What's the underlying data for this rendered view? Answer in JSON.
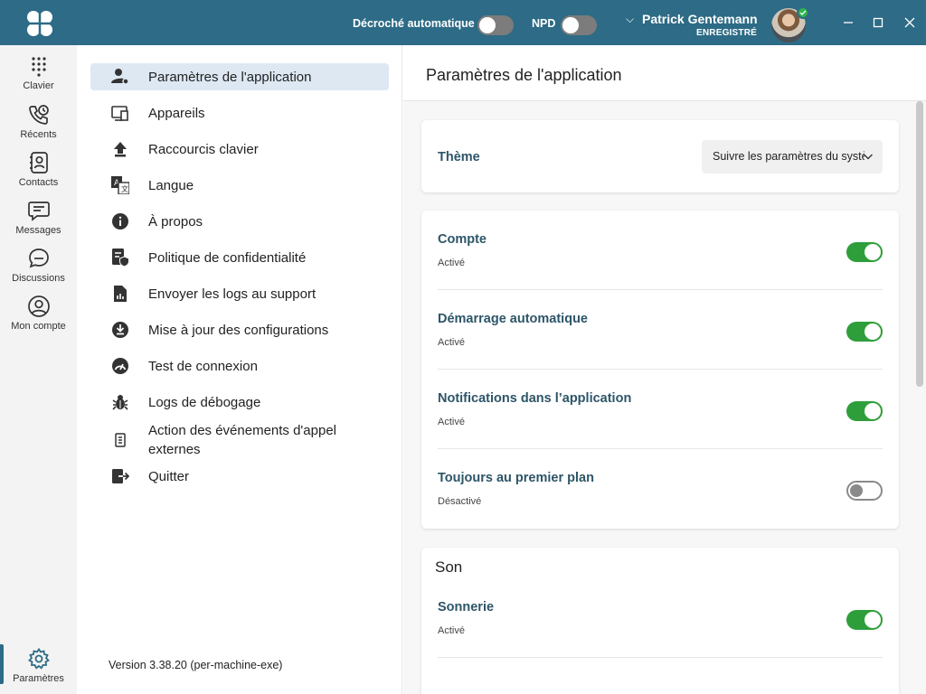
{
  "titlebar": {
    "auto_answer_label": "Décroché automatique",
    "npd_label": "NPD",
    "user_name": "Patrick Gentemann",
    "user_status": "ENREGISTRÉ",
    "status_color": "#2fb44a",
    "brand_color": "#2d6b86"
  },
  "rail": {
    "items": [
      {
        "label": "Clavier",
        "icon": "dialpad-icon"
      },
      {
        "label": "Récents",
        "icon": "recent-calls-icon"
      },
      {
        "label": "Contacts",
        "icon": "contacts-icon"
      },
      {
        "label": "Messages",
        "icon": "messages-icon"
      },
      {
        "label": "Discussions",
        "icon": "discussions-icon"
      },
      {
        "label": "Mon compte",
        "icon": "account-icon"
      }
    ],
    "settings_label": "Paramètres"
  },
  "menu": {
    "items": [
      {
        "label": "Paramètres de l'application",
        "icon": "user-settings-icon"
      },
      {
        "label": "Appareils",
        "icon": "devices-icon"
      },
      {
        "label": "Raccourcis clavier",
        "icon": "shortcut-icon"
      },
      {
        "label": "Langue",
        "icon": "language-icon"
      },
      {
        "label": "À propos",
        "icon": "info-icon"
      },
      {
        "label": "Politique de confidentialité",
        "icon": "privacy-icon"
      },
      {
        "label": "Envoyer les logs au support",
        "icon": "send-logs-icon"
      },
      {
        "label": "Mise à jour des configurations",
        "icon": "download-icon"
      },
      {
        "label": "Test de connexion",
        "icon": "speed-test-icon"
      },
      {
        "label": "Logs de débogage",
        "icon": "bug-icon"
      },
      {
        "label": "Action des événements d'appel externes",
        "icon": "document-icon"
      },
      {
        "label": "Quitter",
        "icon": "exit-icon"
      }
    ],
    "version": "Version 3.38.20 (per-machine-exe)"
  },
  "content": {
    "title": "Paramètres de l'application",
    "theme": {
      "label": "Thème",
      "value": "Suivre les paramètres du système"
    },
    "general_rows": [
      {
        "title": "Compte",
        "status": "Activé",
        "on": true
      },
      {
        "title": "Démarrage automatique",
        "status": "Activé",
        "on": true
      },
      {
        "title": "Notifications dans l’application",
        "status": "Activé",
        "on": true
      },
      {
        "title": "Toujours au premier plan",
        "status": "Désactivé",
        "on": false
      }
    ],
    "sound": {
      "title": "Son",
      "rows": [
        {
          "title": "Sonnerie",
          "status": "Activé",
          "on": true
        }
      ]
    },
    "toggle_on_color": "#2e9e3a"
  }
}
